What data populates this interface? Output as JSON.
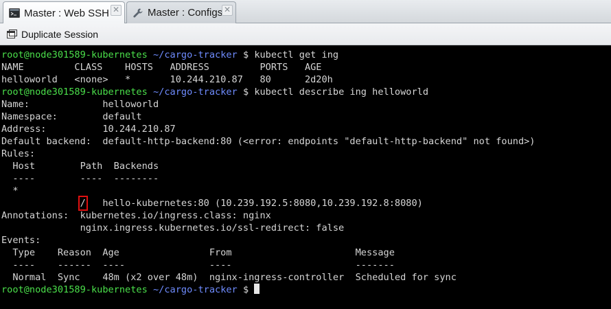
{
  "tabs": [
    {
      "label": "Master : Web SSH",
      "active": true,
      "icon": "terminal-icon"
    },
    {
      "label": "Master : Configs",
      "active": false,
      "icon": "wrench-icon"
    }
  ],
  "toolbar": {
    "duplicate_label": "Duplicate Session",
    "icon": "duplicate-window-icon"
  },
  "terminal": {
    "prompt": {
      "user_host": "root@node301589-kubernetes",
      "path": "~/cargo-tracker",
      "symbol": "$"
    },
    "cmd1": "kubectl get ing",
    "table_header": "NAME         CLASS    HOSTS   ADDRESS         PORTS   AGE",
    "table_row": "helloworld   <none>   *       10.244.210.87   80      2d20h",
    "cmd2": "kubectl describe ing helloworld",
    "name_line": "Name:             helloworld",
    "ns_line": "Namespace:        default",
    "addr_line": "Address:          10.244.210.87",
    "backend_line": "Default backend:  default-http-backend:80 (<error: endpoints \"default-http-backend\" not found>)",
    "rules_line": "Rules:",
    "rules_header": "  Host        Path  Backends",
    "rules_sep": "  ----        ----  --------",
    "rules_star": "  *",
    "path_slash": "/",
    "path_backend": "hello-kubernetes:80 (10.239.192.5:8080,10.239.192.8:8080)",
    "ann1": "Annotations:  kubernetes.io/ingress.class: nginx",
    "ann2": "              nginx.ingress.kubernetes.io/ssl-redirect: false",
    "events_line": "Events:",
    "events_header": "  Type    Reason  Age                From                      Message",
    "events_sep": "  ----    ------  ----               ----                      -------",
    "events_row": "  Normal  Sync    48m (x2 over 48m)  nginx-ingress-controller  Scheduled for sync"
  },
  "colors": {
    "prompt_user": "#4be04b",
    "prompt_path": "#6f8cff",
    "highlight": "#e01010"
  }
}
